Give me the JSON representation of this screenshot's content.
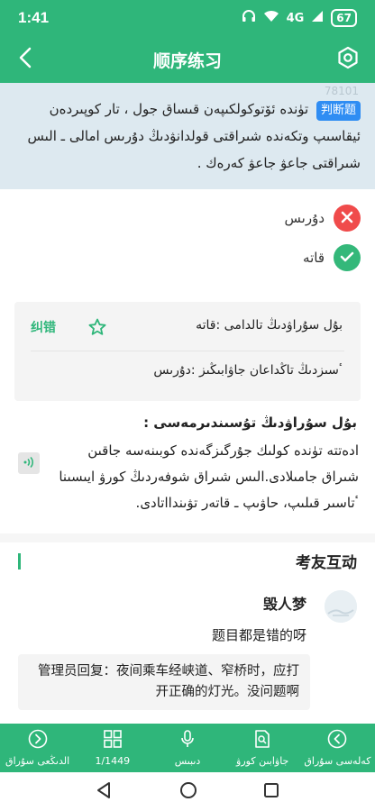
{
  "status_bar": {
    "time": "1:41",
    "network": "4G",
    "battery": "67"
  },
  "header": {
    "title": "顺序练习"
  },
  "question": {
    "id": "78101",
    "type_badge": "判断题",
    "text": "تۈندە ئۆتوكولكىپەن قىساق جول ، تار كوپىردەن ئيقاسىپ وتكەندە شىراقتى قولدانۋدىڭ دۇرىس امالى ـ الىس شىراقتى جاعۋ جاعۋ كەرەك ."
  },
  "options": [
    {
      "label": "دۇرىس",
      "icon": "x-icon",
      "color": "#f04b4b"
    },
    {
      "label": "قاتە",
      "icon": "check-icon",
      "color": "#34b87a"
    }
  ],
  "answer": {
    "report_label": "纠错",
    "your_answer": "بۇل سۇراۋدىڭ تالدامى :قاتە",
    "correct_answer": "ٴسىزدىڭ تاڭداعان جاۋابىڭىز :دۇرىس"
  },
  "explanation": {
    "title": "بۇل سۇراۋدىڭ تۇسىندىرمەسى :",
    "text": "ادەتتە تۈندە كولىك جۇرگىزگەندە كوبىنەسە جاقىن شىراق جامىلادى.الىس شىراق شوفەردىڭ كورۋ ايىسىنا ٴتاسىر قىلىپ، حاۋىپ ـ قاتەر تۋىندااتادى."
  },
  "interaction": {
    "title": "考友互动",
    "comment": {
      "user": "毁人梦",
      "text": "题目都是错的呀"
    },
    "admin_reply": "管理员回复：夜间乘车经峡道、窄桥时，应打开正确的灯光。没问题啊"
  },
  "tabs": [
    {
      "label": "الدىڭعى سۇراق",
      "icon": "chevron-left-circle-icon"
    },
    {
      "label": "1/1449",
      "icon": "grid-icon"
    },
    {
      "label": "دىبىس",
      "icon": "microphone-icon"
    },
    {
      "label": "جاۋابىن كورۋ",
      "icon": "document-search-icon"
    },
    {
      "label": "كەلەسى سۇراق",
      "icon": "chevron-right-circle-icon"
    }
  ],
  "colors": {
    "primary": "#2fb67a",
    "question_bg": "#dde9f0",
    "badge": "#2f8df3"
  }
}
